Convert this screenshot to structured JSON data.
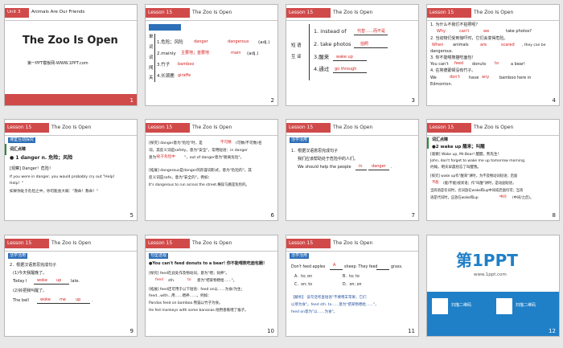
{
  "slides": [
    {
      "num": "1",
      "unit": "Unit 3",
      "unit_title": "Animals Are Our Friends",
      "title": "The Zoo Is Open",
      "footer": "第一PPT模板网-WWW.1PPT.com"
    },
    {
      "num": "2",
      "lesson": "Lesson 15",
      "ltitle": "The Zoo Is Open",
      "side": [
        "单",
        "词",
        "词",
        "闯",
        "关"
      ],
      "rows": [
        "1.危险；风险",
        "2.mainly",
        "3.竹子",
        "4.长颈鹿"
      ],
      "ans": [
        "danger",
        "dangerous",
        "(adj.)",
        "主要地；首要地",
        "main",
        "(adj.)",
        "bamboo",
        "giraffe"
      ]
    },
    {
      "num": "3",
      "lesson": "Lesson 15",
      "ltitle": "The Zoo Is Open",
      "side": [
        "短",
        "语",
        "互",
        "译"
      ],
      "rows": [
        "1. instead of",
        "2. take photos",
        "3.醒来",
        "4.通过"
      ],
      "ans": [
        "代替……而不是",
        "拍照",
        "wake up",
        "go through"
      ]
    },
    {
      "num": "4",
      "lesson": "Lesson 15",
      "ltitle": "The Zoo Is Open",
      "lines": [
        "1. 为什么不我们不拍照呢？",
        "Why",
        "can't",
        "we",
        "take photos?",
        "2. 当动物们受到惊吓时，它们会变得危险。",
        "When",
        "animals",
        "are",
        "scared",
        ", they can be",
        "dangerous.",
        "3. 你不能喂熊猫吃面包！",
        "You can't",
        "feed",
        "donuts",
        "to",
        "a bear!",
        "4. 在埃德蒙顿没有竹子。",
        "We",
        "don't",
        "have",
        "any",
        "bamboo here in",
        "Edmonton."
      ]
    },
    {
      "num": "5",
      "lesson": "Lesson 15",
      "ltitle": "The Zoo Is Open",
      "tag": "课堂互动探究",
      "lines": [
        "词汇点睛",
        "● 1   danger  n. 危险；风险",
        "[观察] Danger！危险！",
        "If you were in danger, you would probably cry out \"Help！",
        "Help！\"",
        "如果你处于危险之中，你可能会大喊：\"救命！救命！\""
      ]
    },
    {
      "num": "6",
      "lesson": "Lesson 15",
      "ltitle": "The Zoo Is Open",
      "lines": [
        "[探究] danger意为\"危险\"时，是",
        "不可数",
        "(可数/不可数)名",
        "词，其反义词是safety，意为\"安全\"，常用短语：in danger",
        "意为\"",
        "处于危险中",
        "\"，out of danger意为\"脱离危险\"。",
        "[拓展] dangerous是danger的形容词形式，意为\"危险的\"，其",
        "反义词是safe，意为\"安全的\"。例如：",
        "It's dangerous to run across the street.横穿马路是危险的。"
      ]
    },
    {
      "num": "7",
      "lesson": "Lesson 15",
      "ltitle": "The Zoo Is Open",
      "tag": "活学活用",
      "lines": [
        "1．根据汉语意思完成句子",
        "我们应该帮助处于危险中的人们。",
        "We should help the people",
        "in",
        "danger",
        "."
      ]
    },
    {
      "num": "8",
      "lesson": "Lesson 15",
      "ltitle": "The Zoo Is Open",
      "lines": [
        "词汇点睛",
        "●2   wake up 醒来；叫醒",
        "[观察] Wake up, Mr.Bear! 醒醒，熊先生！",
        "John, don't forget to wake me up tomorrow morning.",
        "约翰，明天早晨别忘了叫醒我。",
        "[探究] wake up作\"醒来\"讲时，为不及物动词短语；后面",
        "不能",
        "(能/不能)接宾语；作\"叫醒\"讲时，是动副短语，",
        "当宾语是名词时，名词放在wake和up中间或后面均可；当宾",
        "语是代词时，应放在wake和up",
        "中间",
        "(中间/之后)。"
      ]
    },
    {
      "num": "9",
      "lesson": "Lesson 15",
      "ltitle": "The Zoo Is Open",
      "tag": "活学活用",
      "lines": [
        "2．根据汉语意思完成句子",
        "(1)今天我醒晚了。",
        "Today I",
        "woke",
        "up",
        "late.",
        "(2)铃把我叫醒了。",
        "The bell",
        "woke",
        "me",
        "up",
        "."
      ]
    },
    {
      "num": "10",
      "lesson": "Lesson 15",
      "ltitle": "The Zoo Is Open",
      "tag": "句型透视",
      "lines": [
        "●You can't feed donuts to a bear!  你不能喂熊吃面包圈！",
        "[探究] feed在此处作及物动词，意为\"喂；饲养\"。",
        "feed",
        "sth.",
        "to",
        "意为\"把某物喂给……\"。",
        "[拓展] feed还可用于以下短语：feed on以……为食/为生；",
        "feed...with...用……喂养……。例如：",
        "Pandas feed on bamboo.熊猫以竹子为食。",
        "He fed monkeys with some bananas.他用香蕉喂了猴子。"
      ]
    },
    {
      "num": "11",
      "lesson": "Lesson 15",
      "ltitle": "The Zoo Is Open",
      "tag": "活学活用",
      "lines": [
        "Don't feed apples",
        "A",
        "sheep. They feed",
        "grass.",
        "A．to; on",
        "B．to; to",
        "C．on; to",
        "D．on; on",
        "【解析】 该句话考查短语\"不要喂羊苹果，它们",
        "以草为食\"。feed sth. to……意为\"把某物喂给……\"，",
        "feed on意为\"以……为食\"。"
      ]
    },
    {
      "num": "12",
      "logo": "第1PPT",
      "logo_en": "www.1ppt.com",
      "qr1": "扫描二维码",
      "qr2": "扫描二维码"
    }
  ]
}
